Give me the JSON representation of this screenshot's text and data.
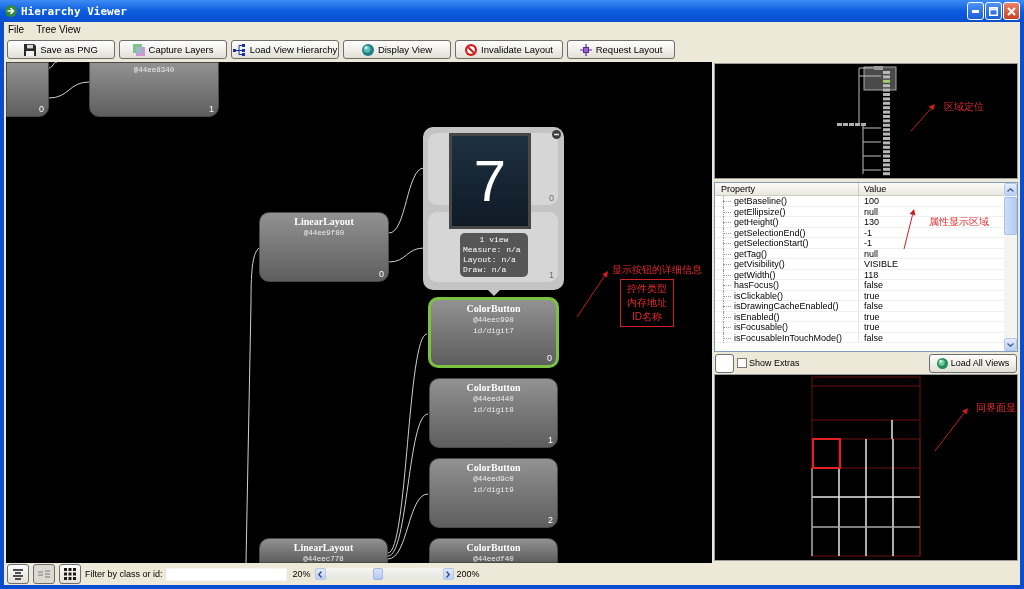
{
  "window": {
    "title": "Hierarchy Viewer"
  },
  "menu": [
    {
      "label": "File"
    },
    {
      "label": "Tree View"
    }
  ],
  "toolbar": [
    {
      "kind": "save",
      "label": "Save as PNG"
    },
    {
      "kind": "capture",
      "label": "Capture Layers"
    },
    {
      "kind": "load",
      "label": "Load View Hierarchy"
    },
    {
      "kind": "display",
      "label": "Display View"
    },
    {
      "kind": "invalidate",
      "label": "Invalidate Layout"
    },
    {
      "kind": "request",
      "label": "Request Layout"
    }
  ],
  "tree": {
    "nodes": [
      {
        "index": "0",
        "selected": false
      },
      {
        "address": "@44ee8340",
        "index": "1",
        "selected": false
      },
      {
        "title": "LinearLayout",
        "address": "@44ee9f80",
        "index": "0",
        "selected": false
      },
      {
        "title": "ColorButton",
        "address": "@44eec998",
        "id": "id/digit7",
        "index": "0",
        "selected": true
      },
      {
        "title": "ColorButton",
        "address": "@44eed440",
        "id": "id/digit8",
        "index": "1",
        "selected": false
      },
      {
        "title": "ColorButton",
        "address": "@44eed9c0",
        "id": "id/digit9",
        "index": "2",
        "selected": false
      },
      {
        "title": "LinearLayout",
        "address": "@44eec778",
        "selected": false
      },
      {
        "title": "ColorButton",
        "address": "@44eedf40",
        "selected": false
      }
    ],
    "tooltip": {
      "children": [
        {
          "index": "0"
        },
        {
          "index": "1"
        }
      ],
      "preview": "7",
      "info": [
        "1 view",
        "Measure: n/a",
        "Layout: n/a",
        "Draw: n/a"
      ]
    }
  },
  "properties": {
    "columns": [
      "Property",
      "Value"
    ],
    "rows": [
      {
        "name": "getBaseline()",
        "value": "100"
      },
      {
        "name": "getEllipsize()",
        "value": "null"
      },
      {
        "name": "getHeight()",
        "value": "130"
      },
      {
        "name": "getSelectionEnd()",
        "value": "-1"
      },
      {
        "name": "getSelectionStart()",
        "value": "-1"
      },
      {
        "name": "getTag()",
        "value": "null"
      },
      {
        "name": "getVisibility()",
        "value": "VISIBLE"
      },
      {
        "name": "getWidth()",
        "value": "118"
      },
      {
        "name": "hasFocus()",
        "value": "false"
      },
      {
        "name": "isClickable()",
        "value": "true"
      },
      {
        "name": "isDrawingCacheEnabled()",
        "value": "false"
      },
      {
        "name": "isEnabled()",
        "value": "true"
      },
      {
        "name": "isFocusable()",
        "value": "true"
      },
      {
        "name": "isFocusableInTouchMode()",
        "value": "false"
      }
    ]
  },
  "extras": {
    "show_extras": {
      "label": "Show Extras",
      "checked": false
    },
    "load_all": {
      "label": "Load All Views"
    }
  },
  "status_bar": {
    "view_buttons": [
      {
        "kind": "list",
        "disabled": false
      },
      {
        "kind": "columns",
        "disabled": true
      },
      {
        "kind": "grid",
        "disabled": false
      }
    ],
    "filter": {
      "label": "Filter by class or id:"
    },
    "zoom": {
      "min": "20%",
      "max": "200%",
      "level": 0.44
    }
  },
  "annotations": [
    {
      "kind": "note",
      "text": "显示按钮的详细信息"
    },
    {
      "kind": "box",
      "lines": [
        "控件类型",
        "内存地址",
        "ID名称"
      ]
    },
    {
      "kind": "note",
      "text": "区域定位"
    },
    {
      "kind": "note",
      "text": "属性显示区域"
    },
    {
      "kind": "note",
      "text": "同界面显"
    }
  ]
}
